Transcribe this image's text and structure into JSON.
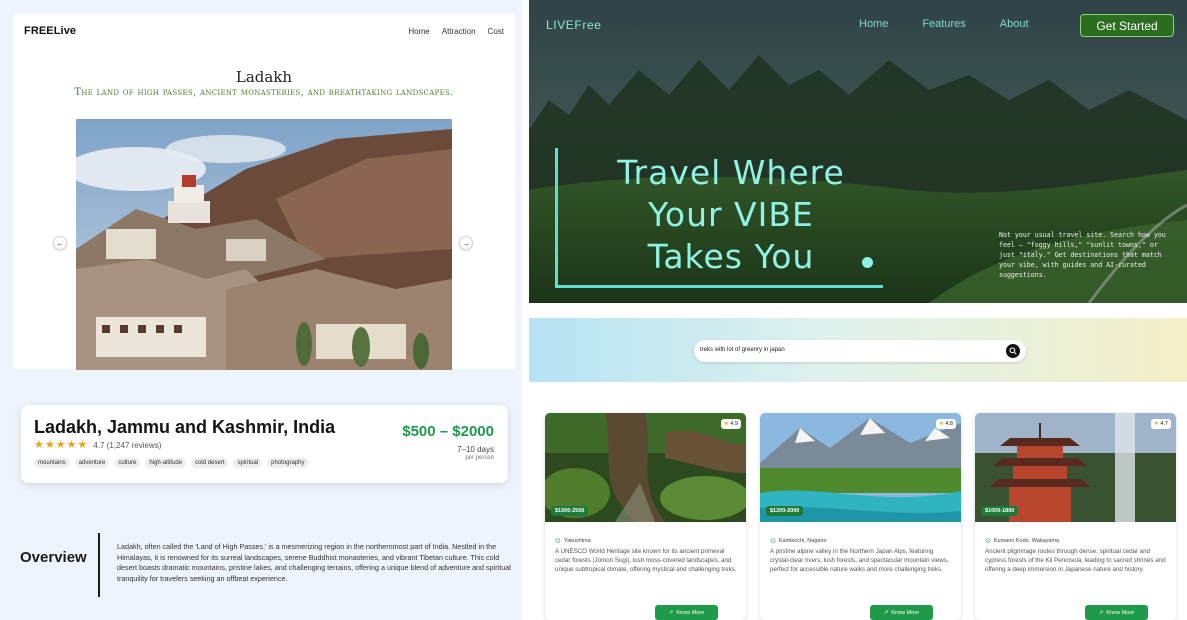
{
  "left": {
    "brand": "FREELive",
    "nav": [
      "Home",
      "Attraction",
      "Cost"
    ],
    "title": "Ladakh",
    "subtitle": "The land of high passes, ancient monasteries, and breathtaking landscapes.",
    "arrow_left": "←",
    "arrow_right": "→",
    "info": {
      "title": "Ladakh, Jammu and Kashmir, India",
      "rating_text": "4.7 (1,247 reviews)",
      "stars": 4.7,
      "tags": [
        "mountains",
        "adventure",
        "culture",
        "high-altitude",
        "cold desert",
        "spiritual",
        "photography"
      ],
      "price": "$500 – $2000",
      "duration": "7–10 days",
      "per_person": "per person"
    },
    "overview": {
      "heading": "Overview",
      "text": "Ladakh, often called the 'Land of High Passes,' is a mesmerizing region in the northernmost part of India. Nestled in the Himalayas, it is renowned for its surreal landscapes, serene Buddhist monasteries, and vibrant Tibetan culture. This cold desert boasts dramatic mountains, pristine lakes, and challenging terrains, offering a unique blend of adventure and spiritual tranquility for travelers seeking an offbeat experience."
    }
  },
  "right": {
    "brand": "LIVEFree",
    "nav": [
      "Home",
      "Features",
      "About"
    ],
    "cta": "Get Started",
    "hero_lines": [
      "Travel Where",
      "Your VIBE",
      "Takes You"
    ],
    "hero_text": "Not your usual travel site. Search how you feel — \"foggy hills,\" \"sunlit towns,\" or just \"italy.\" Get destinations that match your vibe, with guides and AI-curated suggestions.",
    "search_value": "treks with lot of greenry in japan",
    "cards": [
      {
        "rating": "4.9",
        "price": "$1500-2500",
        "location": "Yakushima",
        "description": "A UNESCO World Heritage site known for its ancient primeval cedar forests (Jomon Sugi), lush moss-covered landscapes, and unique subtropical climate, offering mystical and challenging treks.",
        "button": "Know More"
      },
      {
        "rating": "4.8",
        "price": "$1200-2000",
        "location": "Kamikochi, Nagano",
        "description": "A pristine alpine valley in the Northern Japan Alps, featuring crystal-clear rivers, lush forests, and spectacular mountain views, perfect for accessible nature walks and more challenging treks.",
        "button": "Know More"
      },
      {
        "rating": "4.7",
        "price": "$1000-1800",
        "location": "Kumano Kodo, Wakayama",
        "description": "Ancient pilgrimage routes through dense, spiritual cedar and cypress forests of the Kii Peninsula, leading to sacred shrines and offering a deep immersion in Japanese nature and history.",
        "button": "Know More"
      }
    ],
    "colors": {
      "accent_teal": "#8ff2e4",
      "cta_green": "#2b6d1f",
      "button_green": "#1f9a4a",
      "price_green": "#1f9a4a"
    }
  }
}
